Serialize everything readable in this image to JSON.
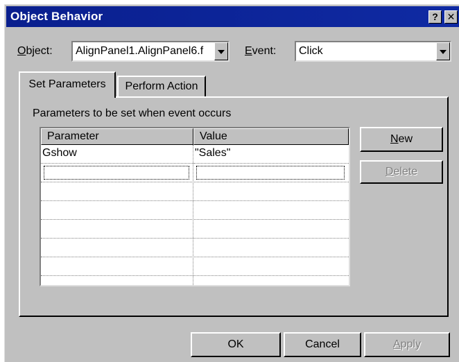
{
  "window": {
    "title": "Object Behavior",
    "help_glyph": "?",
    "close_glyph": "✕"
  },
  "object": {
    "label_mnemonic": "O",
    "label_rest": "bject:",
    "value": "AlignPanel1.AlignPanel6.f"
  },
  "event": {
    "label_mnemonic": "E",
    "label_rest": "vent:",
    "value": "Click"
  },
  "tabs": [
    {
      "label": "Set Parameters",
      "active": true
    },
    {
      "label": "Perform Action",
      "active": false
    }
  ],
  "panel": {
    "caption": "Parameters to be set when event occurs"
  },
  "grid": {
    "columns": [
      "Parameter",
      "Value"
    ],
    "rows": [
      {
        "parameter": "Gshow",
        "value": "\"Sales\""
      }
    ]
  },
  "side_buttons": {
    "new_mnemonic": "N",
    "new_rest": "ew",
    "delete_mnemonic": "D",
    "delete_rest": "elete"
  },
  "footer": {
    "ok": "OK",
    "cancel": "Cancel",
    "apply_mnemonic": "A",
    "apply_rest": "pply"
  },
  "colors": {
    "titlebar": "#0a1f8e",
    "face": "#c0c0c0",
    "disabled_text": "#808080"
  },
  "icons": {
    "combo_arrow": "chevron-down-icon",
    "help": "help-icon",
    "close": "close-icon"
  }
}
